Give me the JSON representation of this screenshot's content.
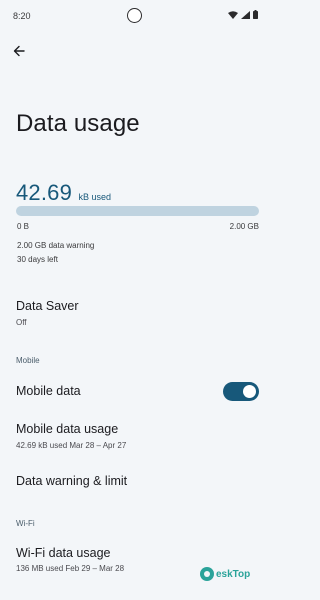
{
  "status_bar": {
    "time": "8:20",
    "icons": [
      "wifi-icon",
      "cellular-signal-icon",
      "battery-icon"
    ]
  },
  "header": {
    "back_icon": "arrow-back-icon",
    "title": "Data usage"
  },
  "usage": {
    "amount": "42.69",
    "unit": "kB used",
    "bar_min_label": "0 B",
    "bar_max_label": "2.00 GB",
    "bar_fraction": 0.0,
    "warning": "2.00 GB data warning",
    "days_left": "30 days left"
  },
  "data_saver": {
    "title": "Data Saver",
    "status": "Off"
  },
  "mobile_section": {
    "header": "Mobile",
    "mobile_data_label": "Mobile data",
    "mobile_data_enabled": true,
    "mobile_data_usage_title": "Mobile data usage",
    "mobile_data_usage_detail": "42.69 kB used Mar 28 – Apr 27",
    "data_warning_limit_title": "Data warning & limit"
  },
  "wifi_section": {
    "header": "Wi-Fi",
    "wifi_data_usage_title": "Wi-Fi data usage",
    "wifi_data_usage_detail": "136 MB used Feb 29 – Mar 28"
  },
  "watermark": {
    "text": "eskTop"
  },
  "colors": {
    "accent": "#17587a",
    "track": "#bfd3e0",
    "background": "#f3f6f9"
  }
}
